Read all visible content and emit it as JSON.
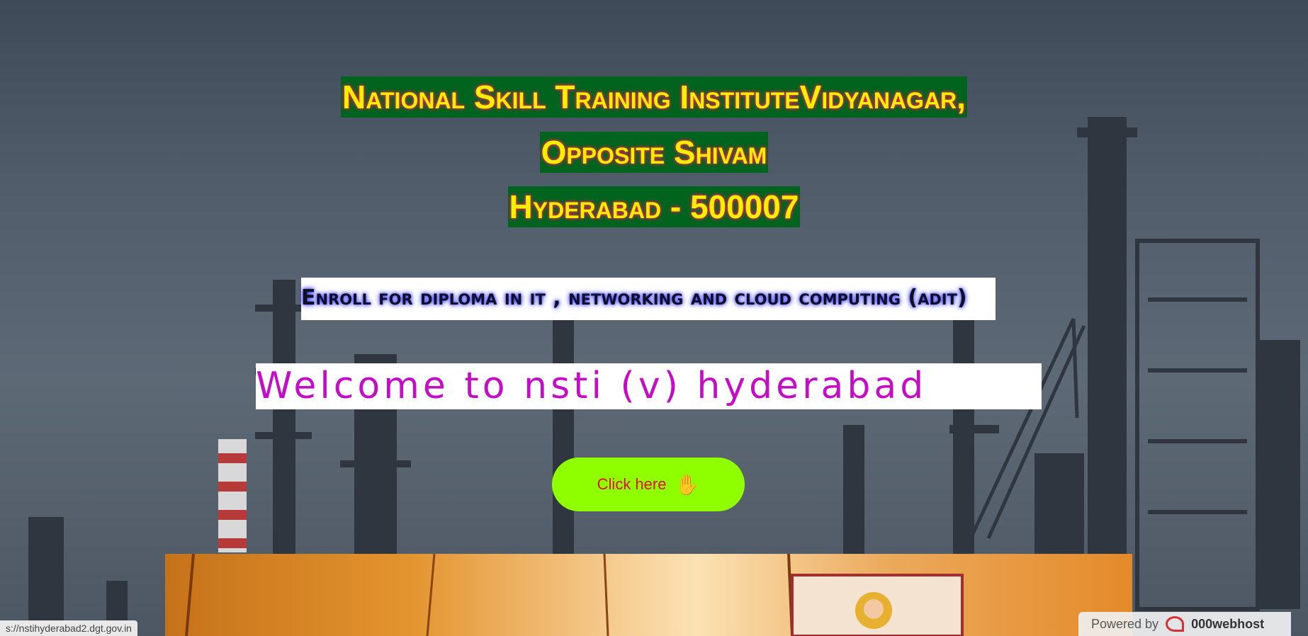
{
  "header": {
    "line1": "National Skill Training InstituteVidyanagar,",
    "line2": "Opposite Shivam",
    "line3": "Hyderabad - 500007"
  },
  "enroll_text": "Enroll for diploma in it , networking and cloud computing (adit)",
  "welcome_text": "Welcome to nsti (v) hyderabad",
  "cta": {
    "label": "Click here",
    "icon": "raised-hand-icon"
  },
  "status_bar": {
    "url": "s://nstihyderabad2.dgt.gov.in"
  },
  "powered_by": {
    "label": "Powered by",
    "brand": "000webhost"
  },
  "colors": {
    "header_text": "#f6f000",
    "header_bg": "#00641e",
    "welcome_text": "#c30ec6",
    "cta_bg": "#8fff00",
    "cta_text": "#e0102a"
  }
}
